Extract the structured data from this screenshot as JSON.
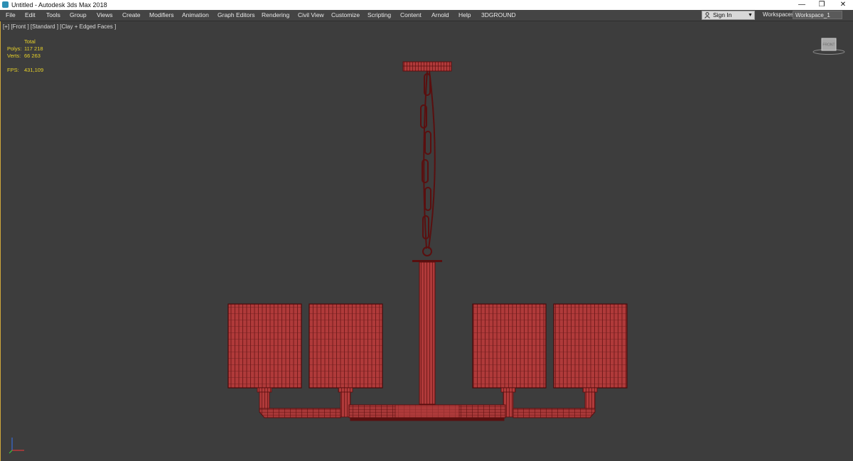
{
  "window": {
    "title": "Untitled - Autodesk 3ds Max 2018",
    "minimize_glyph": "—",
    "maximize_glyph": "❐",
    "close_glyph": "✕"
  },
  "menu": {
    "items": [
      "File",
      "Edit",
      "Tools",
      "Group",
      "Views",
      "Create",
      "Modifiers",
      "Animation",
      "Graph Editors",
      "Rendering",
      "Civil View",
      "Customize",
      "Scripting",
      "Content",
      "Arnold",
      "Help",
      "3DGROUND"
    ],
    "sign_in": "Sign In",
    "workspaces_label": "Workspaces:",
    "workspace_value": "Workspace_1"
  },
  "viewport": {
    "label": "[+] [Front ] [Standard ] [Clay + Edged Faces ]",
    "stats": {
      "header": "Total",
      "polys_label": "Polys:",
      "polys_value": "117 218",
      "verts_label": "Verts:",
      "verts_value": "66 263",
      "fps_label": "FPS:",
      "fps_value": "431,109"
    },
    "viewcube_label": "FRONT",
    "model_color": "#b03a3a",
    "wire_color": "#5a0f0f"
  }
}
